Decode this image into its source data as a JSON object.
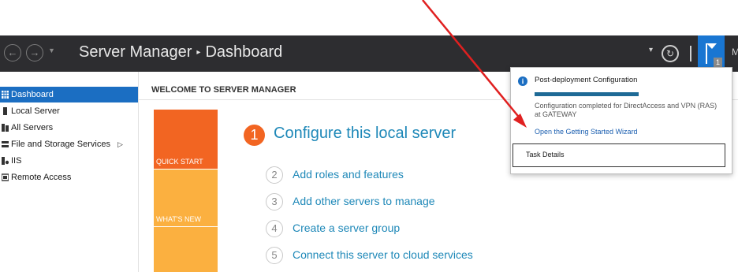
{
  "header": {
    "back_icon": "arrow-left-circle",
    "forward_icon": "arrow-right-circle",
    "dropdown_icon": "chevron-down",
    "app_name": "Server Manager",
    "separator": "▸",
    "page_name": "Dashboard",
    "refresh_icon": "refresh-circle",
    "flag_icon": "notification-flag",
    "flag_count": "1",
    "overflow_text": "M"
  },
  "sidebar": {
    "items": [
      {
        "label": "Dashboard",
        "icon": "dashboard-grid-icon",
        "active": true
      },
      {
        "label": "Local Server",
        "icon": "server-icon"
      },
      {
        "label": "All Servers",
        "icon": "servers-icon"
      },
      {
        "label": "File and Storage Services",
        "icon": "storage-icon",
        "expand": "▷"
      },
      {
        "label": "IIS",
        "icon": "iis-icon"
      },
      {
        "label": "Remote Access",
        "icon": "remote-access-icon"
      }
    ]
  },
  "main": {
    "welcome": "WELCOME TO SERVER MANAGER",
    "tiles": [
      {
        "label": "QUICK START",
        "color": "#f26522"
      },
      {
        "label": "WHAT'S NEW",
        "color": "#fbb040"
      }
    ],
    "steps": [
      {
        "num": "1",
        "label": "Configure this local server"
      },
      {
        "num": "2",
        "label": "Add roles and features"
      },
      {
        "num": "3",
        "label": "Add other servers to manage"
      },
      {
        "num": "4",
        "label": "Create a server group"
      },
      {
        "num": "5",
        "label": "Connect this server to cloud services"
      }
    ]
  },
  "notification": {
    "title": "Post-deployment Configuration",
    "progress": 1.0,
    "message": "Configuration completed for DirectAccess and VPN (RAS) at GATEWAY",
    "link": "Open the Getting Started Wizard",
    "task_details": "Task Details"
  },
  "colors": {
    "header_bg": "#2d2d30",
    "accent_blue": "#1b6ec2",
    "step_blue": "#1e88b8",
    "orange": "#f26522",
    "amber": "#fbb040",
    "annotation_arrow": "#e02020"
  }
}
